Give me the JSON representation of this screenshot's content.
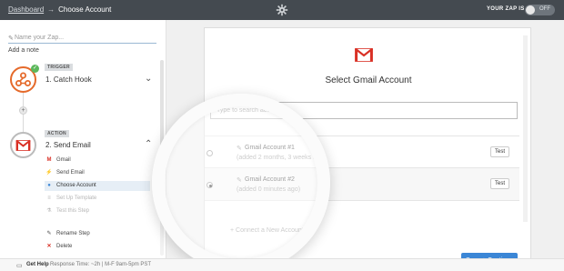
{
  "topbar": {
    "breadcrumb_link": "Dashboard",
    "breadcrumb_sep": "→",
    "breadcrumb_current": "Choose Account",
    "settings_icon": "gear-icon",
    "zap_status_label": "YOUR ZAP IS",
    "toggle_text": "OFF"
  },
  "sidebar": {
    "zap_name_placeholder": "Name your Zap...",
    "add_note": "Add a note",
    "trigger": {
      "badge": "TRIGGER",
      "title": "1. Catch Hook",
      "icon": "webhook-icon",
      "complete_icon": "check-icon"
    },
    "action": {
      "badge": "ACTION",
      "title": "2. Send Email",
      "icon": "gmail-icon",
      "items": [
        {
          "label": "Gmail",
          "icon": "gmail-icon"
        },
        {
          "label": "Send Email",
          "icon": "bolt-icon"
        },
        {
          "label": "Choose Account",
          "icon": "user-icon"
        },
        {
          "label": "Set Up Template",
          "icon": "list-icon"
        },
        {
          "label": "Test this Step",
          "icon": "flask-icon"
        }
      ],
      "extra": [
        {
          "label": "Rename Step",
          "icon": "pencil-icon"
        },
        {
          "label": "Delete",
          "icon": "x-icon"
        }
      ]
    }
  },
  "footer": {
    "help": "Get Help",
    "response": "Response Time: ~2h | M-F 9am-5pm PST"
  },
  "main": {
    "title": "Select Gmail Account",
    "search_placeholder": "Type to search accounts...",
    "accounts": [
      {
        "name": "Gmail Account #1",
        "added": "(added 2 months, 3 weeks ago)",
        "selected": false,
        "test_label": "Test"
      },
      {
        "name": "Gmail Account #2",
        "added": "(added 0 minutes ago)",
        "selected": true,
        "test_label": "Test"
      }
    ],
    "connect_label": "+ Connect a New Account",
    "save_button": "Save + Continue"
  },
  "colors": {
    "topbar": "#444a50",
    "accent_blue": "#3b86d6",
    "trigger_orange": "#e56a2b",
    "gmail_red": "#d93025",
    "success_green": "#5cb85c"
  }
}
